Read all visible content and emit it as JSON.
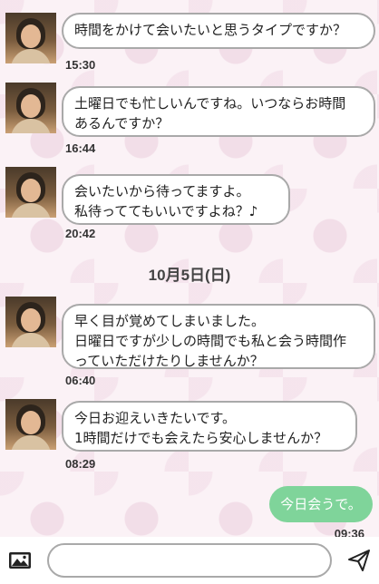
{
  "messages": [
    {
      "lines": [
        "時間をかけて会いたいと思うタイプですか？"
      ],
      "time": "15:30"
    },
    {
      "lines": [
        "土曜日でも忙しいんですね。いつならお時間",
        "あるんですか？"
      ],
      "time": "16:44"
    },
    {
      "lines": [
        "会いたいから待ってますよ。",
        "私待っててもいいですよね？♪"
      ],
      "time": "20:42"
    },
    {
      "lines": [
        "早く目が覚めてしまいました。",
        "日曜日ですが少しの時間でも私と会う時間作",
        "っていただけたりしませんか？"
      ],
      "time": "06:40"
    },
    {
      "lines": [
        "今日お迎えいきたいです。",
        "1時間だけでも会えたら安心しませんか？"
      ],
      "time": "08:29"
    }
  ],
  "date_separator": "10月5日(日)",
  "my_message": {
    "text": "今日会うで。",
    "time": "09:36"
  },
  "input": {
    "placeholder": "",
    "value": ""
  },
  "icons": {
    "attach": "image-icon",
    "send": "send-icon"
  },
  "colors": {
    "my_bubble": "#7fd49a",
    "bubble_border": "#a9a9a9",
    "background": "#fbf2f6"
  }
}
